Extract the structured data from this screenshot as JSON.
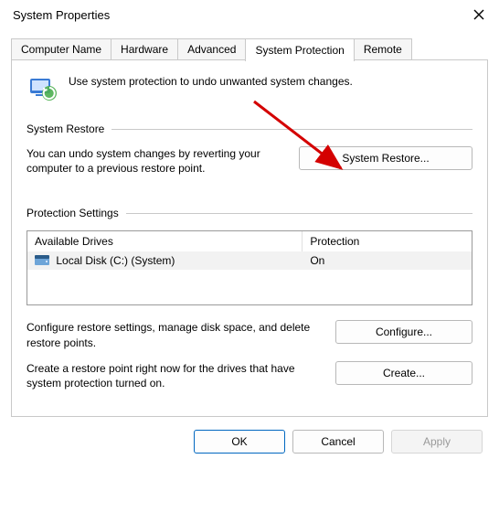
{
  "window": {
    "title": "System Properties"
  },
  "tabs": {
    "computer_name": "Computer Name",
    "hardware": "Hardware",
    "advanced": "Advanced",
    "system_protection": "System Protection",
    "remote": "Remote"
  },
  "intro": {
    "text": "Use system protection to undo unwanted system changes."
  },
  "sections": {
    "system_restore": {
      "header": "System Restore",
      "desc": "You can undo system changes by reverting your computer to a previous restore point.",
      "button": "System Restore..."
    },
    "protection_settings": {
      "header": "Protection Settings",
      "columns": {
        "drive": "Available Drives",
        "protection": "Protection"
      },
      "rows": [
        {
          "drive": "Local Disk (C:) (System)",
          "protection": "On"
        }
      ],
      "configure_desc": "Configure restore settings, manage disk space, and delete restore points.",
      "configure_button": "Configure...",
      "create_desc": "Create a restore point right now for the drives that have system protection turned on.",
      "create_button": "Create..."
    }
  },
  "dialog_buttons": {
    "ok": "OK",
    "cancel": "Cancel",
    "apply": "Apply"
  },
  "annotation": {
    "color": "#D40000"
  }
}
